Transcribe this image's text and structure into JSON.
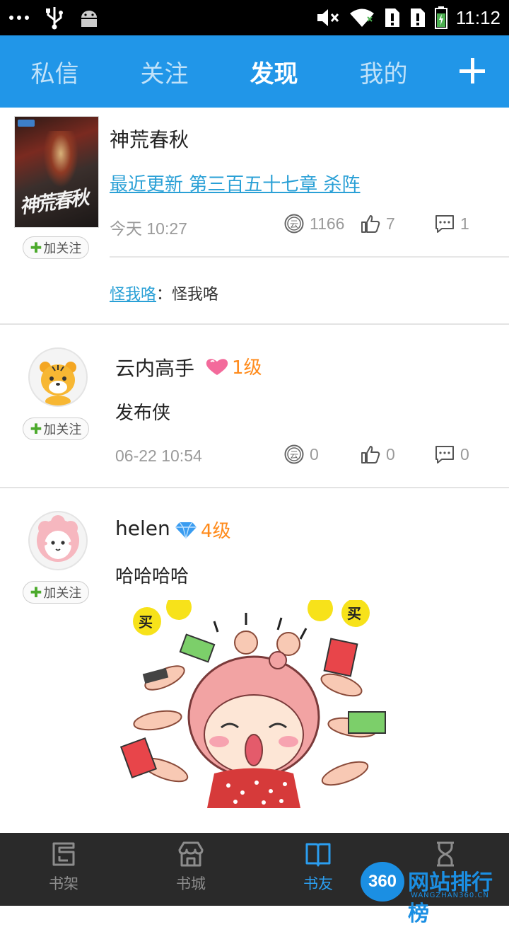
{
  "status_bar": {
    "time": "11:12",
    "icons": [
      "more-dots-icon",
      "usb-icon",
      "android-icon",
      "mute-icon",
      "wifi-icon",
      "sim-alert-icon",
      "sim-alert-icon",
      "battery-charging-icon"
    ]
  },
  "top_nav": {
    "tabs": [
      {
        "label": "私信",
        "active": false
      },
      {
        "label": "关注",
        "active": false
      },
      {
        "label": "发现",
        "active": true
      },
      {
        "label": "我的",
        "active": false
      }
    ],
    "add_icon": "plus-icon"
  },
  "feed": {
    "posts": [
      {
        "type": "book",
        "cover_title": "神荒春秋",
        "title": "神荒春秋",
        "link_text": "最近更新 第三百五十七章 杀阵",
        "time": "今天 10:27",
        "coins": "1166",
        "likes": "7",
        "comments": "1",
        "follow_label": "加关注",
        "comment": {
          "author": "怪我咯",
          "separator": "：",
          "text": "怪我咯"
        }
      },
      {
        "type": "user",
        "username": "云内高手",
        "level": "1级",
        "level_icon": "heart-icon",
        "text": "发布侠",
        "time": "06-22 10:54",
        "coins": "0",
        "likes": "0",
        "comments": "0",
        "follow_label": "加关注"
      },
      {
        "type": "user",
        "username": "helen",
        "level": "4级",
        "level_icon": "diamond-icon",
        "text": "哈哈哈哈",
        "follow_label": "加关注"
      }
    ]
  },
  "bottom_nav": {
    "items": [
      {
        "label": "书架",
        "icon": "bookshelf-icon",
        "active": false
      },
      {
        "label": "书城",
        "icon": "store-icon",
        "active": false
      },
      {
        "label": "书友",
        "icon": "book-friends-icon",
        "active": true
      },
      {
        "label": "",
        "icon": "hourglass-icon",
        "active": false
      }
    ]
  },
  "watermark": {
    "badge": "360",
    "text": "网站排行榜",
    "sub": "WANGZHAN360.CN"
  },
  "colors": {
    "accent": "#2196e8",
    "link": "#2aa0d6",
    "level": "#ff8a1a",
    "nav_bg": "#2a2a2a"
  }
}
